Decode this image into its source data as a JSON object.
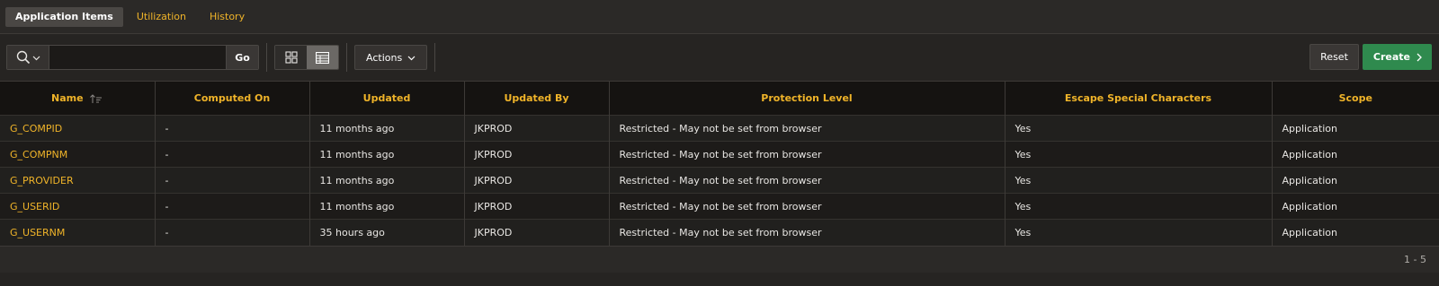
{
  "tabs": [
    {
      "label": "Application Items",
      "active": true
    },
    {
      "label": "Utilization",
      "active": false
    },
    {
      "label": "History",
      "active": false
    }
  ],
  "toolbar": {
    "search_icon": "search-icon",
    "search_value": "",
    "go_label": "Go",
    "actions_label": "Actions",
    "reset_label": "Reset",
    "create_label": "Create"
  },
  "colors": {
    "accent": "#f0b429",
    "create_button": "#2f8a4e"
  },
  "table": {
    "columns": [
      "Name",
      "Computed On",
      "Updated",
      "Updated By",
      "Protection Level",
      "Escape Special Characters",
      "Scope"
    ],
    "rows": [
      [
        "G_COMPID",
        "-",
        "11 months ago",
        "JKPROD",
        "Restricted - May not be set from browser",
        "Yes",
        "Application"
      ],
      [
        "G_COMPNM",
        "-",
        "11 months ago",
        "JKPROD",
        "Restricted - May not be set from browser",
        "Yes",
        "Application"
      ],
      [
        "G_PROVIDER",
        "-",
        "11 months ago",
        "JKPROD",
        "Restricted - May not be set from browser",
        "Yes",
        "Application"
      ],
      [
        "G_USERID",
        "-",
        "11 months ago",
        "JKPROD",
        "Restricted - May not be set from browser",
        "Yes",
        "Application"
      ],
      [
        "G_USERNM",
        "-",
        "35 hours ago",
        "JKPROD",
        "Restricted - May not be set from browser",
        "Yes",
        "Application"
      ]
    ]
  },
  "pagination": "1 - 5"
}
